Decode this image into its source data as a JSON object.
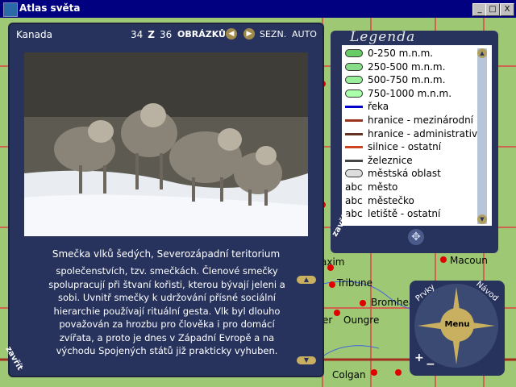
{
  "window": {
    "title": "Atlas světa",
    "minimize": "_",
    "maximize": "□",
    "close": "X"
  },
  "article": {
    "country": "Kanada",
    "current": "34",
    "separator": "Z",
    "total": "36",
    "images_label": "OBRÁZKŮ",
    "prev": "◀",
    "next": "▶",
    "list_label": "SEZN.",
    "auto_label": "AUTO",
    "caption": "Smečka vlků šedých, Severozápadní teritorium",
    "description": "společenstvích, tzv. smečkách. Členové smečky spolupracují při štvaní kořisti, kterou bývají jeleni a sobi. Uvnitř smečky k udržování přísné sociální hierarchie používají rituální gesta. Vlk byl dlouho považován za hrozbu pro člověka i pro domácí zvířata, a proto je dnes v Západní Evropě a na východu Spojených států již prakticky vyhuben.",
    "close_label": "zavřít",
    "scroll_up": "▲",
    "scroll_down": "▼"
  },
  "legend": {
    "title": "Legenda",
    "close_label": "zavřít",
    "move_icon": "✥",
    "scroll_up": "▲",
    "scroll_down": "▼",
    "items": [
      {
        "kind": "ellipse",
        "color": "#66cc66",
        "label": "0-250 m.n.m."
      },
      {
        "kind": "ellipse",
        "color": "#88dd88",
        "label": "250-500 m.n.m."
      },
      {
        "kind": "ellipse",
        "color": "#99ee99",
        "label": "500-750 m.n.m."
      },
      {
        "kind": "ellipse",
        "color": "#aaffaa",
        "label": "750-1000 m.n.m."
      },
      {
        "kind": "line",
        "color": "#0000cc",
        "label": "řeka"
      },
      {
        "kind": "line",
        "color": "#993322",
        "label": "hranice - mezinárodní"
      },
      {
        "kind": "line",
        "color": "#663322",
        "label": "hranice - administrativní"
      },
      {
        "kind": "line",
        "color": "#cc4422",
        "label": "silnice - ostatní"
      },
      {
        "kind": "line",
        "color": "#444444",
        "label": "železnice"
      },
      {
        "kind": "ellipse",
        "color": "#dddddd",
        "label": "městská oblast"
      },
      {
        "kind": "text",
        "sample": "abc",
        "label": "město"
      },
      {
        "kind": "text",
        "sample": "abc",
        "label": "městečko"
      },
      {
        "kind": "text",
        "sample": "abc",
        "label": "letiště - ostatní"
      }
    ]
  },
  "map": {
    "cities": [
      {
        "name": "Tribune"
      },
      {
        "name": "Bromhead"
      },
      {
        "name": "Oungre"
      },
      {
        "name": "Colgan"
      },
      {
        "name": "Macoun"
      },
      {
        "name": "axim"
      },
      {
        "name": "er"
      }
    ]
  },
  "compass": {
    "menu": "Menu",
    "prvky": "Prvky",
    "navod": "Návod",
    "plus": "+",
    "minus": "−"
  }
}
